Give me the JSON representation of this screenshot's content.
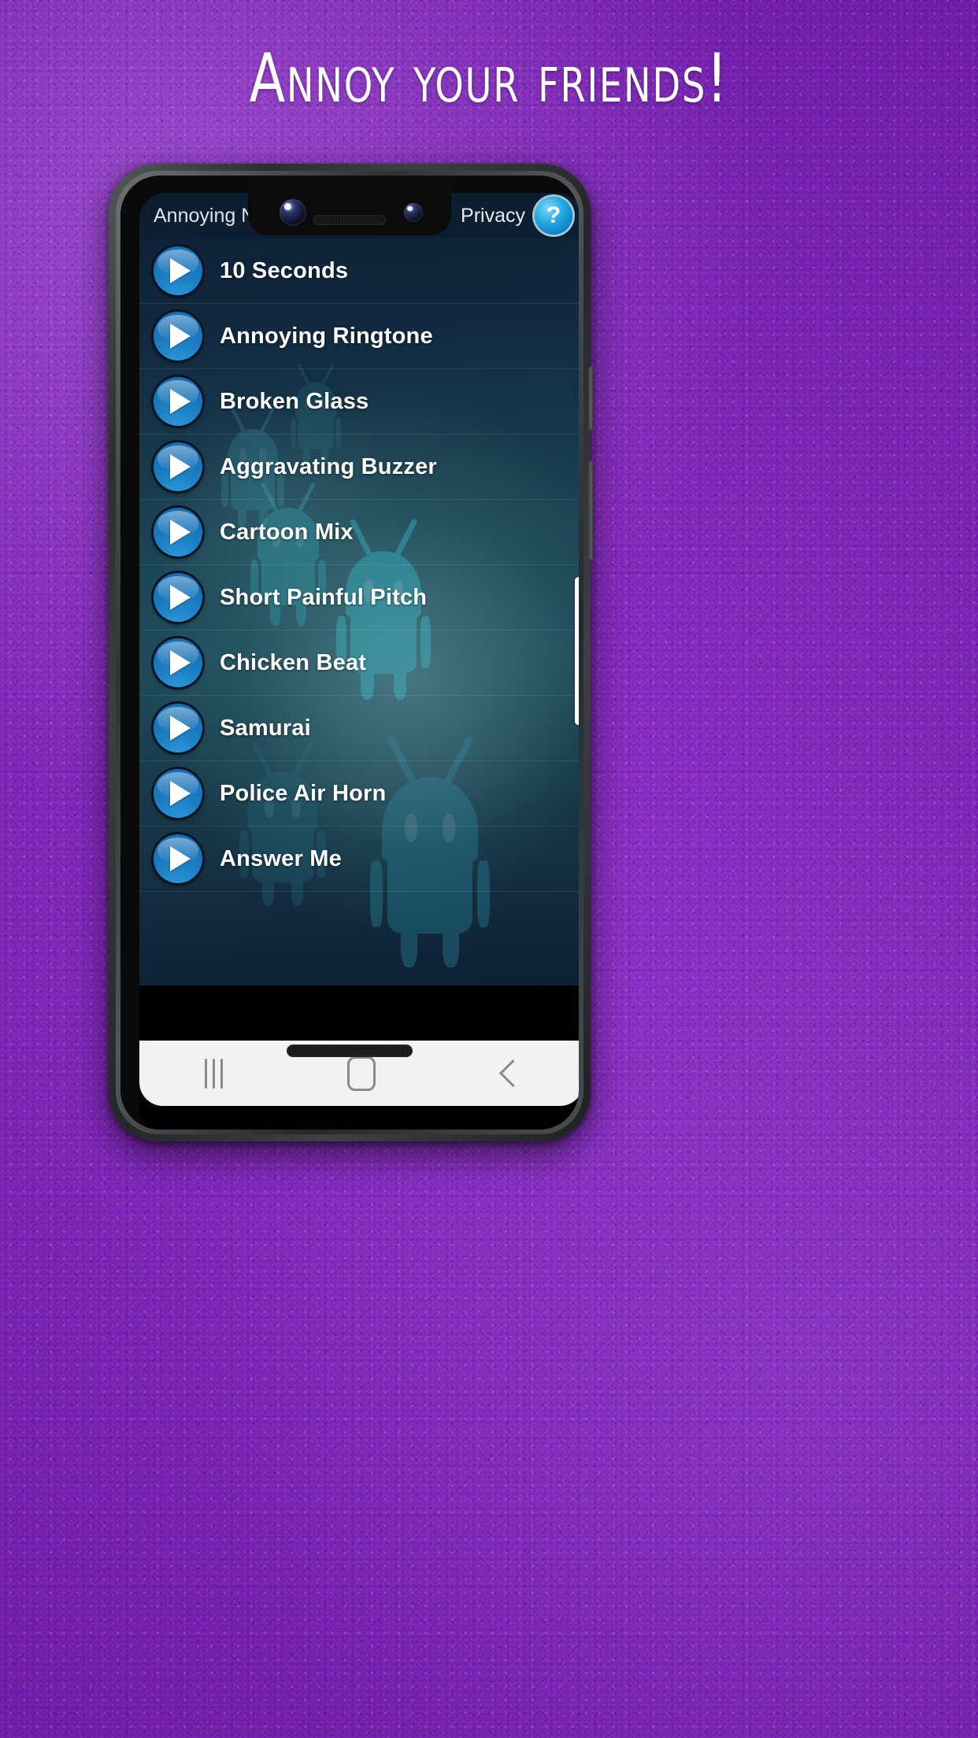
{
  "promo": {
    "headline": "Annoy your friends!"
  },
  "phone": {
    "notch": {
      "camera_main_icon": "camera-lens-icon",
      "camera_secondary_icon": "camera-lens-icon",
      "earpiece_icon": "earpiece-speaker-icon"
    },
    "bottom_speaker_icon": "speaker-grille-icon",
    "side_buttons": {
      "power_label": "power-button",
      "volume_label": "volume-button"
    }
  },
  "app": {
    "action_bar": {
      "title": "Annoying Notifications",
      "privacy_label": "Privacy",
      "help_icon": "help-question-icon",
      "help_glyph": "?"
    },
    "sounds": [
      {
        "name": "10 Seconds",
        "play_icon": "play-icon"
      },
      {
        "name": "Annoying Ringtone",
        "play_icon": "play-icon"
      },
      {
        "name": "Broken Glass",
        "play_icon": "play-icon"
      },
      {
        "name": "Aggravating Buzzer",
        "play_icon": "play-icon"
      },
      {
        "name": "Cartoon Mix",
        "play_icon": "play-icon"
      },
      {
        "name": "Short Painful Pitch",
        "play_icon": "play-icon"
      },
      {
        "name": "Chicken Beat",
        "play_icon": "play-icon"
      },
      {
        "name": "Samurai",
        "play_icon": "play-icon"
      },
      {
        "name": "Police Air Horn",
        "play_icon": "play-icon"
      },
      {
        "name": "Answer Me",
        "play_icon": "play-icon"
      }
    ],
    "scrollbar": {
      "position_label": "scroll-thumb"
    }
  },
  "navbar": {
    "recents_icon": "recents-icon",
    "home_icon": "home-icon",
    "back_icon": "back-chevron-icon"
  },
  "colors": {
    "backdrop_purple": "#7a27b0",
    "headline_white": "#ffffff",
    "play_button_blue": "#1c7fc4",
    "help_icon_blue": "#23a8e0",
    "app_bg_dark_teal": "#1b4454",
    "navbar_grey": "#f2f2f2"
  }
}
